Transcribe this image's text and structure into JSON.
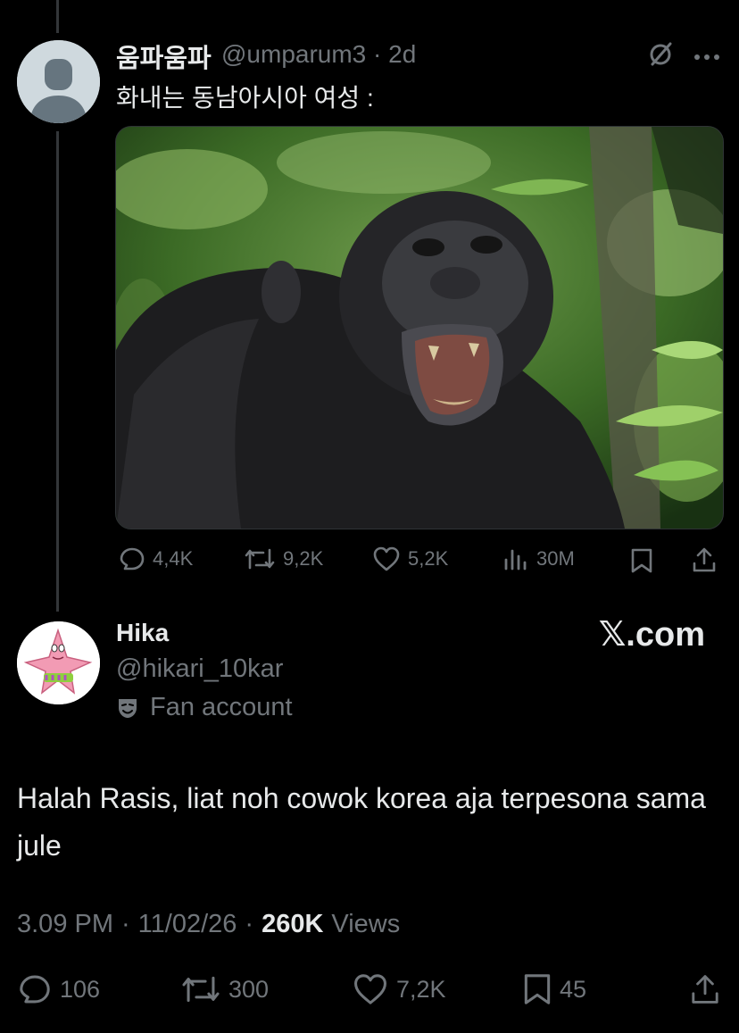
{
  "parent_tweet": {
    "display_name": "움파움파",
    "handle": "@umparum3",
    "time": "· 2d",
    "text": "화내는 동남아시아 여성 :",
    "image_alt": "chimpanzee-photo",
    "stats": {
      "replies": "4,4K",
      "retweets": "9,2K",
      "likes": "5,2K",
      "views": "30M"
    },
    "icons": [
      "grok-icon",
      "more-icon",
      "reply-icon",
      "retweet-icon",
      "like-icon",
      "views-icon",
      "bookmark-icon",
      "share-icon"
    ]
  },
  "main_tweet": {
    "display_name": "Hika",
    "handle": "@hikari_10kar",
    "fan_label": "Fan account",
    "brand": "𝕏.com",
    "text": "Halah Rasis, liat noh cowok korea aja terpesona sama jule",
    "time": "3.09 PM",
    "date": "11/02/26",
    "views_count": "260K",
    "views_label": "Views",
    "sep1": "·",
    "sep2": "·",
    "stats": {
      "replies": "106",
      "retweets": "300",
      "likes": "7,2K",
      "bookmarks": "45"
    }
  },
  "colors": {
    "background": "#000000",
    "text": "#e7e9ea",
    "muted": "#71767b",
    "thread_line": "#333639"
  }
}
